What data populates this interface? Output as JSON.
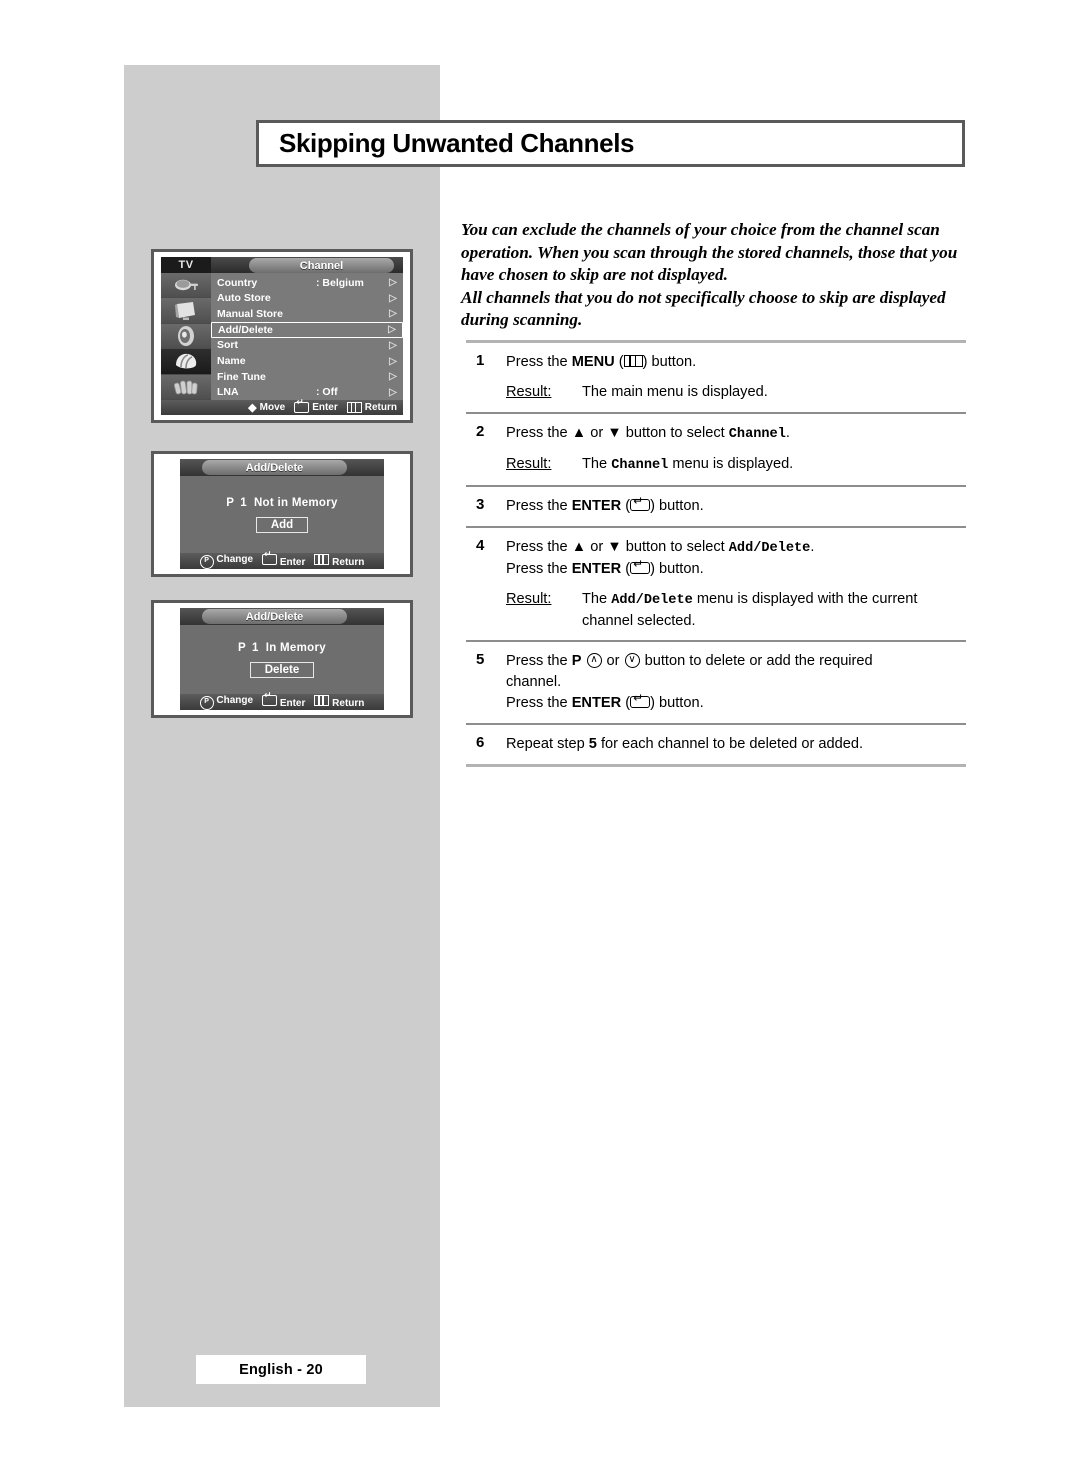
{
  "page": {
    "title": "Skipping Unwanted Channels",
    "footer_label": "English - 20",
    "colors": {
      "band_gray": "#cdcdcd",
      "frame_border": "#5a5a5a",
      "rule_gray": "#b3b3b3",
      "osd_background": "#6e6e6e"
    }
  },
  "intro": {
    "paragraph1": "You can exclude the channels of your choice from the channel scan operation. When you scan through the stored channels, those that you have chosen to skip are not displayed.",
    "paragraph2": "All channels that you do not specifically choose to skip are displayed during scanning."
  },
  "steps": [
    {
      "number": "1",
      "lines": [
        {
          "pre": "Press the ",
          "bold": "MENU",
          "mid": " (",
          "icon": "menu-icon",
          "post": ") button."
        }
      ],
      "result_label": "Result:",
      "result_text": "The main menu is displayed."
    },
    {
      "number": "2",
      "lines": [
        {
          "pre": "Press the ▲ or ▼ button to select ",
          "mono": "Channel",
          "post": "."
        }
      ],
      "result_label": "Result:",
      "result_prefix": "The ",
      "result_mono": "Channel",
      "result_suffix": " menu is displayed."
    },
    {
      "number": "3",
      "lines": [
        {
          "pre": "Press the ",
          "bold": "ENTER",
          "mid": " (",
          "icon": "enter-icon",
          "post": ") button."
        }
      ]
    },
    {
      "number": "4",
      "lines": [
        {
          "pre": "Press the ▲ or ▼ button to select ",
          "mono": "Add/Delete",
          "post": "."
        },
        {
          "pre": "Press the ",
          "bold": "ENTER",
          "mid": " (",
          "icon": "enter-icon",
          "post": ") button."
        }
      ],
      "result_label": "Result:",
      "result_prefix": "The ",
      "result_mono": "Add/Delete",
      "result_suffix": " menu is displayed with the current channel selected."
    },
    {
      "number": "5",
      "lines": [
        {
          "pre": "Press the ",
          "bold": "P",
          "icons": [
            "circle-up-icon",
            "circle-down-icon"
          ],
          "post": " button to delete or add the required channel."
        },
        {
          "pre": "Press the ",
          "bold": "ENTER",
          "mid": " (",
          "icon": "enter-icon",
          "post": ") button."
        }
      ]
    },
    {
      "number": "6",
      "lines": [
        {
          "pre": "Repeat step ",
          "bold": "5",
          "post": " for each channel to be deleted or added."
        }
      ]
    }
  ],
  "step_text": {
    "press_the": "Press the ",
    "menu_word": "MENU",
    "enter_word": "ENTER",
    "open_paren": " (",
    "close_paren_button": ") button.",
    "select_prefix_arrows": "Press the ▲ or ▼ button to select ",
    "period": ".",
    "result_label": "Result:",
    "result_main_menu": "The main menu is displayed.",
    "the_word": "The ",
    "menu_is_displayed": " menu is displayed.",
    "menu_is_displayed_current": " menu is displayed with the current",
    "channel_selected": "channel selected.",
    "channel_word": "Channel",
    "add_delete_word": "Add/Delete",
    "step5_press_p": "Press the ",
    "step5_p": "P",
    "step5_or": " or ",
    "step5_tail": " button to delete or add the required",
    "step5_channel": "channel.",
    "step6_pre": "Repeat step ",
    "step6_num": "5",
    "step6_post": " for each channel to be deleted or added."
  },
  "osd_channel_menu": {
    "tv_label": "TV",
    "title": "Channel",
    "icons": [
      "antenna-icon",
      "tv-picture-icon",
      "speaker-sound-icon",
      "hand-setup-icon",
      "fingers-icon"
    ],
    "selected_icon_index": 3,
    "rows": [
      {
        "label": "Country",
        "value": ": Belgium",
        "arrow": "▷",
        "highlighted": false
      },
      {
        "label": "Auto Store",
        "value": "",
        "arrow": "▷",
        "highlighted": false
      },
      {
        "label": "Manual Store",
        "value": "",
        "arrow": "▷",
        "highlighted": false
      },
      {
        "label": "Add/Delete",
        "value": "",
        "arrow": "▷",
        "highlighted": true
      },
      {
        "label": "Sort",
        "value": "",
        "arrow": "▷",
        "highlighted": false
      },
      {
        "label": "Name",
        "value": "",
        "arrow": "▷",
        "highlighted": false
      },
      {
        "label": "Fine Tune",
        "value": "",
        "arrow": "▷",
        "highlighted": false
      },
      {
        "label": "LNA",
        "value": ": Off",
        "arrow": "▷",
        "highlighted": false
      }
    ],
    "bottom_bar": [
      {
        "icon": "up-down-arrows-icon",
        "label": "Move"
      },
      {
        "icon": "enter-key-icon",
        "label": "Enter"
      },
      {
        "icon": "return-menu-icon",
        "label": "Return"
      }
    ]
  },
  "osd_add_delete_not_in_memory": {
    "title": "Add/Delete",
    "prefix": "P",
    "channel_number": "1",
    "status": "Not in Memory",
    "button_label": "Add",
    "bottom_bar": [
      {
        "icon": "change-icon",
        "label": "Change"
      },
      {
        "icon": "enter-key-icon",
        "label": "Enter"
      },
      {
        "icon": "return-menu-icon",
        "label": "Return"
      }
    ]
  },
  "osd_add_delete_in_memory": {
    "title": "Add/Delete",
    "prefix": "P",
    "channel_number": "1",
    "status": "In Memory",
    "button_label": "Delete",
    "bottom_bar": [
      {
        "icon": "change-icon",
        "label": "Change"
      },
      {
        "icon": "enter-key-icon",
        "label": "Enter"
      },
      {
        "icon": "return-menu-icon",
        "label": "Return"
      }
    ]
  }
}
